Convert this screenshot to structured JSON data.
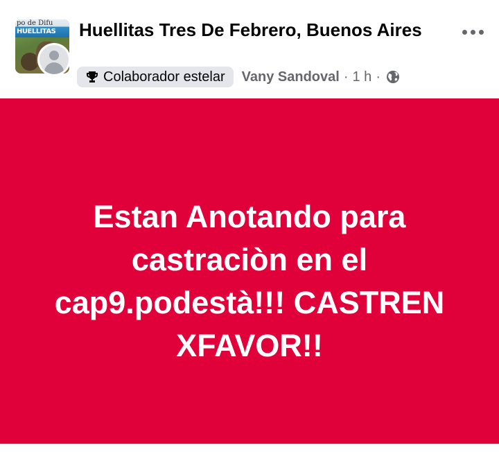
{
  "header": {
    "group_title": "Huellitas Tres De Febrero, Buenos Aires",
    "group_avatar_text_top": "po de Difu",
    "group_avatar_text_bottom": "HUELLITAS",
    "badge_label": "Colaborador estelar",
    "author_name": "Vany Sandoval",
    "separator": "·",
    "time": "1 h",
    "icons": {
      "badge": "trophy-icon",
      "privacy": "globe-icon",
      "menu": "more-options-icon"
    }
  },
  "post": {
    "background_color": "#e0003a",
    "text": "Estan Anotando para castraciòn en el cap9.podestà!!! CASTREN XFAVOR!!"
  }
}
